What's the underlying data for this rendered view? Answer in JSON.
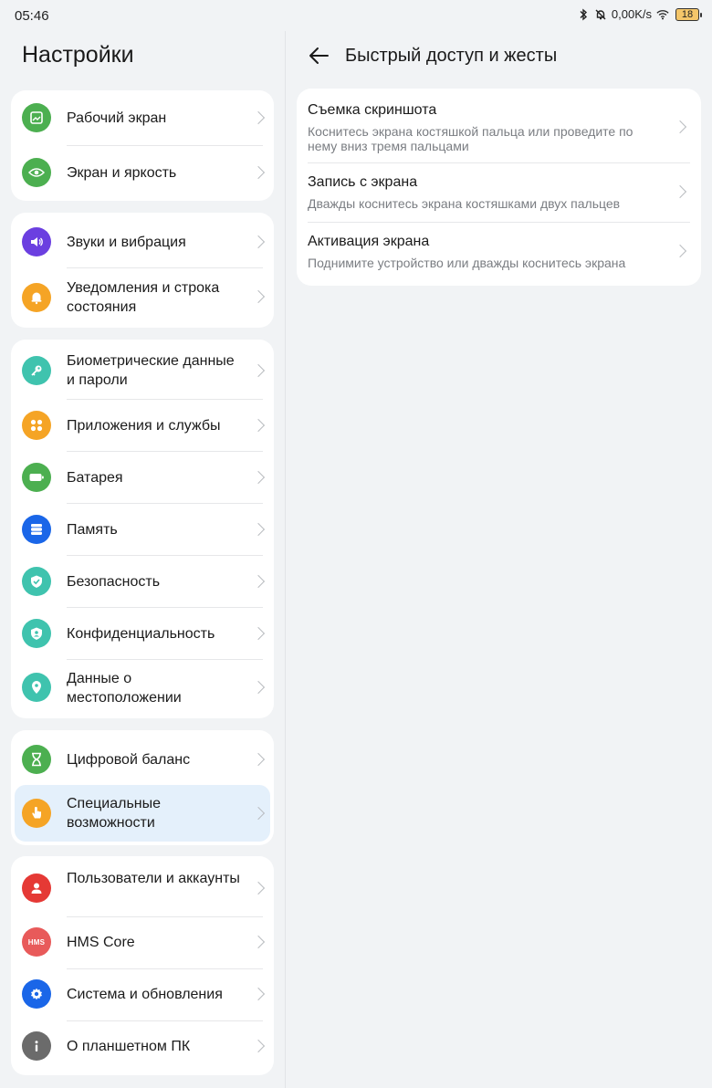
{
  "status_bar": {
    "time": "05:46",
    "net_speed": "0,00K/s",
    "battery_level": "18",
    "icons": [
      "bluetooth-icon",
      "bell-off-icon",
      "wifi-icon",
      "battery-icon"
    ]
  },
  "left": {
    "title": "Настройки",
    "groups": [
      {
        "items": [
          {
            "label": "Рабочий экран",
            "icon": "home-screen-icon",
            "color": "#4caf50"
          },
          {
            "label": "Экран и яркость",
            "icon": "eye-icon",
            "color": "#4caf50"
          }
        ]
      },
      {
        "items": [
          {
            "label": "Звуки и вибрация",
            "icon": "speaker-icon",
            "color": "#6b3fe0"
          },
          {
            "label": "Уведомления и строка состояния",
            "icon": "bell-icon",
            "color": "#f5a425"
          }
        ]
      },
      {
        "items": [
          {
            "label": "Биометрические данные и пароли",
            "icon": "key-icon",
            "color": "#3fc3ae"
          },
          {
            "label": "Приложения и службы",
            "icon": "apps-icon",
            "color": "#f5a425"
          },
          {
            "label": "Батарея",
            "icon": "battery-icon",
            "color": "#4caf50"
          },
          {
            "label": "Память",
            "icon": "storage-icon",
            "color": "#1a66e8"
          },
          {
            "label": "Безопасность",
            "icon": "shield-check-icon",
            "color": "#3fc3ae"
          },
          {
            "label": "Конфиденциальность",
            "icon": "privacy-shield-icon",
            "color": "#3fc3ae"
          },
          {
            "label": "Данные о местоположении",
            "icon": "location-pin-icon",
            "color": "#3fc3ae"
          }
        ]
      },
      {
        "items": [
          {
            "label": "Цифровой баланс",
            "icon": "hourglass-icon",
            "color": "#4caf50"
          },
          {
            "label": "Специальные возможности",
            "icon": "hand-icon",
            "color": "#f5a425",
            "selected": true
          }
        ]
      },
      {
        "items": [
          {
            "label": "Пользователи и аккаунты",
            "icon": "user-icon",
            "color": "#e53935"
          },
          {
            "label": "HMS Core",
            "icon": "hms-icon",
            "color": "#e85a5a",
            "icon_text": "HMS"
          },
          {
            "label": "Система и обновления",
            "icon": "gear-icon",
            "color": "#1a66e8"
          },
          {
            "label": "О планшетном ПК",
            "icon": "info-icon",
            "color": "#6b6b6b"
          }
        ]
      }
    ]
  },
  "right": {
    "title": "Быстрый доступ и жесты",
    "items": [
      {
        "title": "Съемка скриншота",
        "subtitle": "Коснитесь экрана костяшкой пальца или проведите по нему вниз тремя пальцами"
      },
      {
        "title": "Запись с экрана",
        "subtitle": "Дважды коснитесь экрана костяшками двух пальцев"
      },
      {
        "title": "Активация экрана",
        "subtitle": "Поднимите устройство или дважды коснитесь экрана"
      }
    ]
  }
}
